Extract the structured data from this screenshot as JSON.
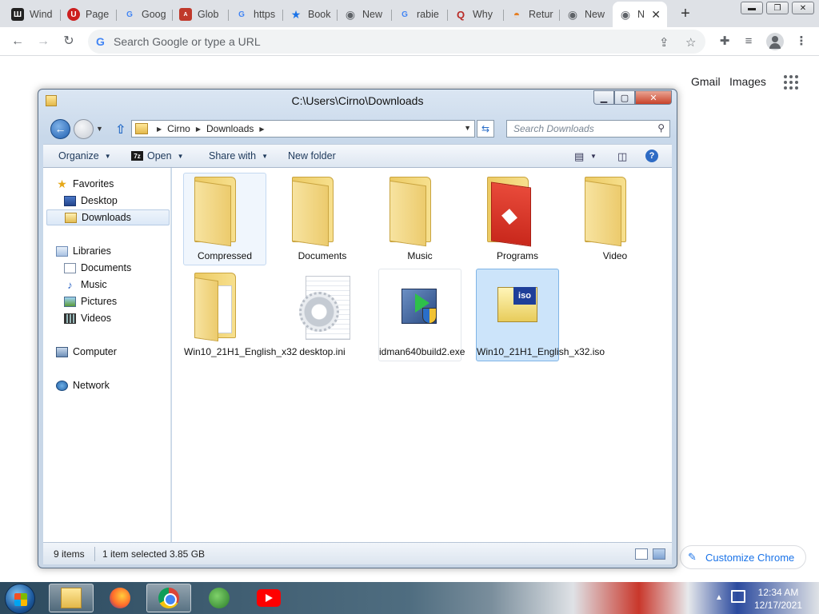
{
  "browser": {
    "tabs": [
      {
        "label": "Wind",
        "favicon": "wiki-icon",
        "color": "#222222",
        "glyph": "W"
      },
      {
        "label": "Page",
        "favicon": "ublock-icon",
        "color": "#cc1f1f",
        "glyph": "U"
      },
      {
        "label": "Goog",
        "favicon": "google-icon",
        "color": "#ffffff",
        "glyph": "G"
      },
      {
        "label": "Glob",
        "favicon": "aus-icon",
        "color": "#c0392b",
        "glyph": "A"
      },
      {
        "label": "https",
        "favicon": "google-icon",
        "color": "#ffffff",
        "glyph": "G"
      },
      {
        "label": "Book",
        "favicon": "star-icon",
        "color": "#ffffff",
        "glyph": "★"
      },
      {
        "label": "New",
        "favicon": "chrome-icon",
        "color": "#ffffff",
        "glyph": "◉"
      },
      {
        "label": "rabie",
        "favicon": "google-icon",
        "color": "#ffffff",
        "glyph": "G"
      },
      {
        "label": "Why",
        "favicon": "quora-icon",
        "color": "#b92b27",
        "glyph": "Q"
      },
      {
        "label": "Retur",
        "favicon": "rainbow-icon",
        "color": "#ffffff",
        "glyph": "◓"
      },
      {
        "label": "New",
        "favicon": "chrome-icon",
        "color": "#ffffff",
        "glyph": "◉"
      },
      {
        "label": "N",
        "favicon": "chrome-icon",
        "color": "#ffffff",
        "glyph": "◉",
        "active": true
      }
    ],
    "tab_close_glyph": "✕",
    "new_tab_glyph": "+",
    "omnibox_placeholder": "Search Google or type a URL",
    "ntp": {
      "gmail": "Gmail",
      "images": "Images",
      "customize": "Customize Chrome"
    }
  },
  "explorer": {
    "title": "C:\\Users\\Cirno\\Downloads",
    "breadcrumb": [
      "Cirno",
      "Downloads"
    ],
    "search_placeholder": "Search Downloads",
    "commands": {
      "organize": "Organize",
      "open": "Open",
      "share_with": "Share with",
      "new_folder": "New folder"
    },
    "open_badge": "7z",
    "help_glyph": "?",
    "nav": {
      "favorites": "Favorites",
      "desktop": "Desktop",
      "downloads": "Downloads",
      "libraries": "Libraries",
      "documents": "Documents",
      "music": "Music",
      "pictures": "Pictures",
      "videos": "Videos",
      "computer": "Computer",
      "network": "Network"
    },
    "files": [
      {
        "name": "Compressed",
        "kind": "folder",
        "state": "hover"
      },
      {
        "name": "Documents",
        "kind": "folder"
      },
      {
        "name": "Music",
        "kind": "folder"
      },
      {
        "name": "Programs",
        "kind": "folder-red"
      },
      {
        "name": "Video",
        "kind": "folder"
      },
      {
        "name": "Win10_21H1_English_x32",
        "kind": "folder-docs"
      },
      {
        "name": "desktop.ini",
        "kind": "ini"
      },
      {
        "name": "idman640build2.exe",
        "kind": "exe"
      },
      {
        "name": "Win10_21H1_English_x32.iso",
        "kind": "iso",
        "state": "selected",
        "badge": "iso"
      }
    ],
    "status": {
      "count": "9 items",
      "selected": "1 item selected",
      "size": "3.85 GB"
    }
  },
  "taskbar": {
    "time": "12:34 AM",
    "date": "12/17/2021"
  }
}
